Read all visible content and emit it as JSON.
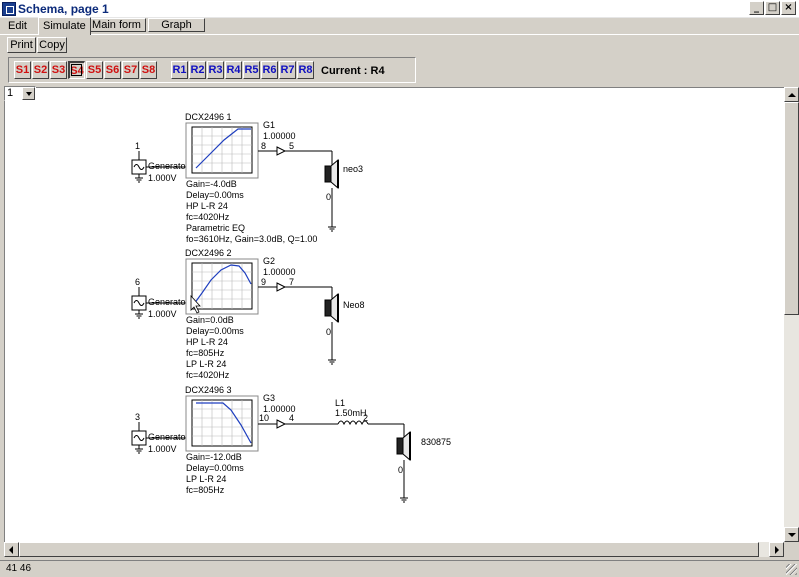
{
  "window": {
    "title": "Schema, page 1",
    "controls": {
      "minimize": "_",
      "maximize": "□",
      "close": "×"
    }
  },
  "tabs": [
    {
      "label": "Edit"
    },
    {
      "label": "Simulate"
    }
  ],
  "tab_buttons": [
    {
      "label": "Main form"
    },
    {
      "label": "Graph"
    }
  ],
  "toolbar": {
    "print_label": "Print",
    "copy_label": "Copy"
  },
  "selectors": {
    "sources": [
      "S1",
      "S2",
      "S3",
      "S4",
      "S5",
      "S6",
      "S7",
      "S8"
    ],
    "receivers": [
      "R1",
      "R2",
      "R3",
      "R4",
      "R5",
      "R6",
      "R7",
      "R8"
    ],
    "pressed": "S4",
    "current_text": "Current : R4"
  },
  "page_select": {
    "value": "1"
  },
  "schematic": {
    "chains": [
      {
        "node_in": "1",
        "generator_label": "Generator",
        "generator_level": "1.000V",
        "dsp_title": "DCX2496 1",
        "dsp_params": [
          "Gain=-4.0dB",
          "Delay=0.00ms",
          "HP L-R 24",
          " fc=4020Hz",
          "Parametric EQ",
          " fo=3610Hz, Gain=3.0dB, Q=1.00"
        ],
        "gain_name": "G1",
        "gain_value": "1.00000",
        "node_a": "8",
        "node_b": "5",
        "speaker_name": "neo3",
        "ground_node": "0"
      },
      {
        "node_in": "6",
        "generator_label": "Generator",
        "generator_level": "1.000V",
        "dsp_title": "DCX2496 2",
        "dsp_params": [
          "Gain=0.0dB",
          "Delay=0.00ms",
          "HP L-R 24",
          " fc=805Hz",
          "LP L-R 24",
          " fc=4020Hz"
        ],
        "gain_name": "G2",
        "gain_value": "1.00000",
        "node_a": "9",
        "node_b": "7",
        "speaker_name": "Neo8",
        "ground_node": "0"
      },
      {
        "node_in": "3",
        "generator_label": "Generator 1",
        "generator_level": "1.000V",
        "dsp_title": "DCX2496 3",
        "dsp_params": [
          "Gain=-12.0dB",
          "Delay=0.00ms",
          "LP L-R 24",
          " fc=805Hz"
        ],
        "gain_name": "G3",
        "gain_value": "1.00000",
        "node_a": "10",
        "node_b": "4",
        "inductor_name": "L1",
        "inductor_value": "1.50mH",
        "inductor_node": "2",
        "speaker_name": "830875",
        "ground_node": "0"
      }
    ]
  },
  "status": {
    "coords": "41  46"
  }
}
